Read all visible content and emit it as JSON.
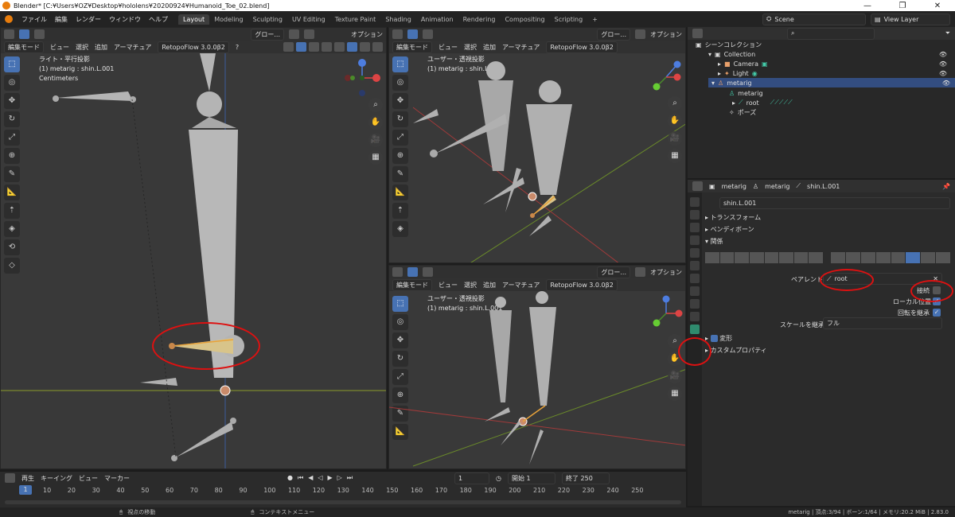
{
  "window": {
    "title": "Blender* [C:¥Users¥OZ¥Desktop¥hololens¥20200924¥Humanoid_Toe_02.blend]",
    "minimize": "—",
    "maximize": "❐",
    "close": "✕"
  },
  "menu": [
    "ファイル",
    "編集",
    "レンダー",
    "ウィンドウ",
    "ヘルプ"
  ],
  "workspaces": [
    "Layout",
    "Modeling",
    "Sculpting",
    "UV Editing",
    "Texture Paint",
    "Shading",
    "Animation",
    "Rendering",
    "Compositing",
    "Scripting"
  ],
  "active_workspace": "Layout",
  "scene_name": "Scene",
  "view_layer": "View Layer",
  "viewport_left": {
    "mode": "編集モード",
    "menus": [
      "ビュー",
      "選択",
      "追加",
      "アーマチュア"
    ],
    "addon": "RetopoFlow 3.0.0β2",
    "transform": "グロー...",
    "options": "オプション",
    "view_name": "ライト・平行投影",
    "object_info": "(1) metarig : shin.L.001",
    "units": "Centimeters"
  },
  "viewport_tr": {
    "mode": "編集モード",
    "menus": [
      "ビュー",
      "選択",
      "追加",
      "アーマチュア"
    ],
    "addon": "RetopoFlow 3.0.0β2",
    "transform": "グロー...",
    "options": "オプション",
    "view_name": "ユーザー・透視投影",
    "object_info": "(1) metarig : shin.L.001"
  },
  "viewport_br": {
    "mode": "編集モード",
    "menus": [
      "ビュー",
      "選択",
      "追加",
      "アーマチュア"
    ],
    "addon": "RetopoFlow 3.0.0β2",
    "transform": "グロー...",
    "options": "オプション",
    "view_name": "ユーザー・透視投影",
    "object_info": "(1) metarig : shin.L.001"
  },
  "outliner": {
    "root": "シーンコレクション",
    "items": [
      {
        "label": "Collection"
      },
      {
        "label": "Camera"
      },
      {
        "label": "Light"
      },
      {
        "label": "metarig"
      },
      {
        "label": "metarig"
      },
      {
        "label": "root"
      },
      {
        "label": "ポーズ"
      }
    ]
  },
  "properties": {
    "breadcrumb": [
      "metarig",
      "metarig",
      "shin.L.001"
    ],
    "bone_name": "shin.L.001",
    "sections": {
      "transform": "トランスフォーム",
      "bendy": "ベンディボーン",
      "relations": "関係",
      "deform": "変形",
      "custom": "カスタムプロパティ"
    },
    "parent_label": "ペアレント",
    "parent_value": "root",
    "connect_label": "接続",
    "local_location_label": "ローカル位置",
    "inherit_rotation_label": "回転を継承",
    "inherit_scale_label": "スケールを継承",
    "inherit_scale_value": "フル"
  },
  "timeline": {
    "menus": [
      "再生",
      "キーイング",
      "ビュー",
      "マーカー"
    ],
    "current_frame": "1",
    "start_label": "開始",
    "start": "1",
    "end_label": "終了",
    "end": "250",
    "ruler": [
      "10",
      "20",
      "30",
      "40",
      "50",
      "60",
      "70",
      "80",
      "90",
      "100",
      "110",
      "120",
      "130",
      "140",
      "150",
      "160",
      "170",
      "180",
      "190",
      "200",
      "210",
      "220",
      "230",
      "240",
      "250"
    ]
  },
  "status": {
    "left": "視点の移動",
    "middle": "コンテキストメニュー",
    "right": "metarig | 頂点:3/94 | ボーン:1/64 | メモリ:20.2 MiB | 2.83.0"
  },
  "colors": {
    "accent": "#4772b3",
    "highlight_ellipse": "#dd1111",
    "bone_active": "#e8a23a",
    "bone_gray": "#b4b4b4"
  }
}
